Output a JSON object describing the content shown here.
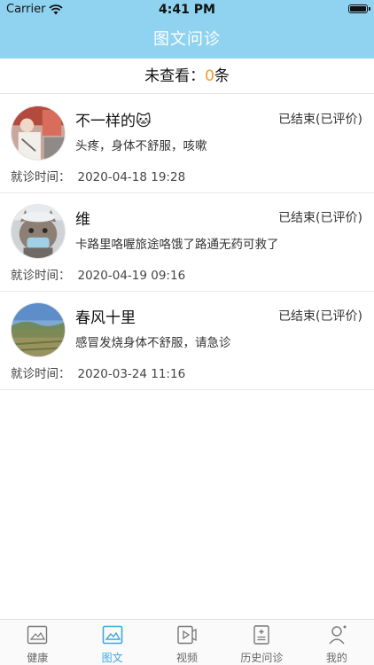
{
  "status_bar": {
    "carrier": "Carrier",
    "time": "4:41 PM"
  },
  "header": {
    "title": "图文问诊",
    "background": "#8fd3f0"
  },
  "unread": {
    "prefix": "未查看：",
    "count": "0",
    "suffix": "条",
    "count_color": "#f39a2b"
  },
  "consultations": [
    {
      "name": "不一样的🐱",
      "status": "已结束(已评价)",
      "description": "头疼，身体不舒服，咳嗽",
      "visit_label": "就诊时间：",
      "visit_time": "2020-04-18 19:28",
      "avatar_icon": "avatar-photo-person"
    },
    {
      "name": "维",
      "status": "已结束(已评价)",
      "description": "卡路里咯喔旅途咯饿了路通无药可救了",
      "visit_label": "就诊时间：",
      "visit_time": "2020-04-19 09:16",
      "avatar_icon": "avatar-photo-cat"
    },
    {
      "name": "春风十里",
      "status": "已结束(已评价)",
      "description": "感冒发烧身体不舒服，请急诊",
      "visit_label": "就诊时间：",
      "visit_time": "2020-03-24 11:16",
      "avatar_icon": "avatar-photo-landscape"
    }
  ],
  "tabs": [
    {
      "label": "健康",
      "icon": "image-icon",
      "active": false
    },
    {
      "label": "图文",
      "icon": "image-chat-icon",
      "active": true
    },
    {
      "label": "视频",
      "icon": "video-icon",
      "active": false
    },
    {
      "label": "历史问诊",
      "icon": "medical-record-icon",
      "active": false
    },
    {
      "label": "我的",
      "icon": "profile-icon",
      "active": false
    }
  ],
  "colors": {
    "accent": "#3ea7dc",
    "inactive_tab": "#666666"
  }
}
